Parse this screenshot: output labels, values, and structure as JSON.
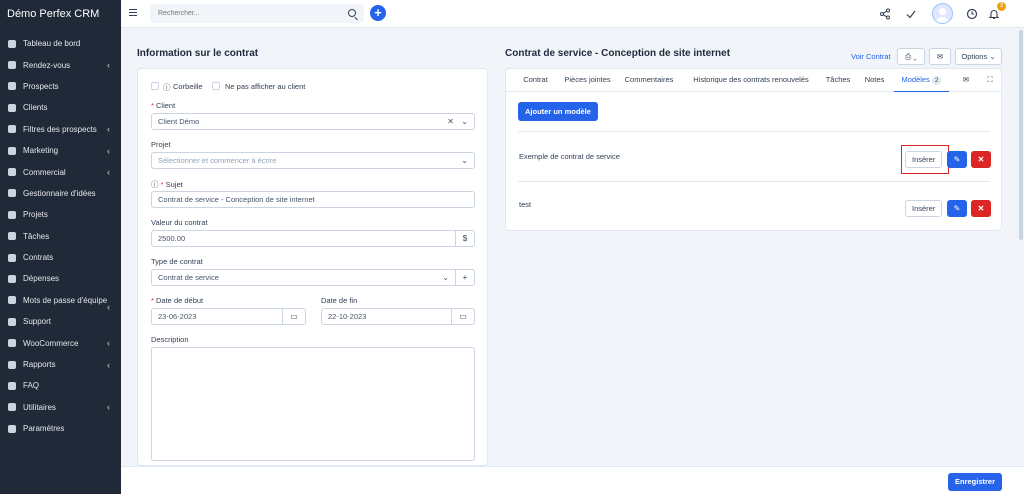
{
  "app": {
    "title": "Démo Perfex CRM"
  },
  "sidebar": {
    "items": [
      {
        "label": "Tableau de bord",
        "icon": "home-icon",
        "chev": ""
      },
      {
        "label": "Rendez-vous",
        "icon": "calendar-icon",
        "chev": "‹"
      },
      {
        "label": "Prospects",
        "icon": "prospects-icon",
        "chev": ""
      },
      {
        "label": "Clients",
        "icon": "user-icon",
        "chev": ""
      },
      {
        "label": "Filtres des prospects",
        "icon": "filter-icon",
        "chev": "‹"
      },
      {
        "label": "Marketing",
        "icon": "target-icon",
        "chev": "‹"
      },
      {
        "label": "Commercial",
        "icon": "file-icon",
        "chev": "‹"
      },
      {
        "label": "Gestionnaire d'idées",
        "icon": "lightbulb-icon",
        "chev": ""
      },
      {
        "label": "Projets",
        "icon": "chart-icon",
        "chev": ""
      },
      {
        "label": "Tâches",
        "icon": "check-circle-icon",
        "chev": ""
      },
      {
        "label": "Contrats",
        "icon": "document-icon",
        "chev": ""
      },
      {
        "label": "Dépenses",
        "icon": "receipt-icon",
        "chev": ""
      },
      {
        "label": "Mots de passe d'équipe",
        "icon": "key-icon",
        "chev": "‹"
      },
      {
        "label": "Support",
        "icon": "lifebuoy-icon",
        "chev": ""
      },
      {
        "label": "WooCommerce",
        "icon": "cart-icon",
        "chev": "‹"
      },
      {
        "label": "Rapports",
        "icon": "report-icon",
        "chev": "‹"
      },
      {
        "label": "FAQ",
        "icon": "folder-icon",
        "chev": ""
      },
      {
        "label": "Utilitaires",
        "icon": "tools-icon",
        "chev": "‹"
      },
      {
        "label": "Paramètres",
        "icon": "gear-icon",
        "chev": ""
      }
    ]
  },
  "topbar": {
    "search_placeholder": "Rechercher...",
    "plus": "+",
    "bell_count": "3"
  },
  "form": {
    "title": "Information sur le contrat",
    "trash_label": "Corbeille",
    "hide_label": "Ne pas afficher au client",
    "client_label": "Client",
    "client_value": "Client Démo",
    "project_label": "Projet",
    "project_placeholder": "Sélectionner et commencer à écrire",
    "subject_label": "Sujet",
    "subject_value": "Contrat de service - Conception de site internet",
    "value_label": "Valeur du contrat",
    "value_value": "2500.00",
    "currency": "$",
    "type_label": "Type de contrat",
    "type_value": "Contrat de service",
    "start_label": "Date de début",
    "start_value": "23-06-2023",
    "end_label": "Date de fin",
    "end_value": "22-10-2023",
    "desc_label": "Description"
  },
  "contract": {
    "title": "Contrat de service - Conception de site internet",
    "view_link": "Voir Contrat",
    "options_label": "Options",
    "tabs": [
      {
        "label": "Contrat"
      },
      {
        "label": "Pièces jointes"
      },
      {
        "label": "Commentaires"
      },
      {
        "label": "Historique des contrats renouvelés"
      },
      {
        "label": "Tâches"
      },
      {
        "label": "Notes"
      },
      {
        "label": "Modèles",
        "badge": "2"
      }
    ],
    "add_template": "Ajouter un modèle",
    "templates": [
      {
        "name": "Exemple de contrat de service",
        "insert": "Insérer"
      },
      {
        "name": "test",
        "insert": "Insérer"
      }
    ]
  },
  "footer": {
    "save_label": "Enregistrer"
  },
  "colors": {
    "primary": "#2563eb",
    "danger": "#dc2626",
    "sidebar": "#1f2937"
  }
}
